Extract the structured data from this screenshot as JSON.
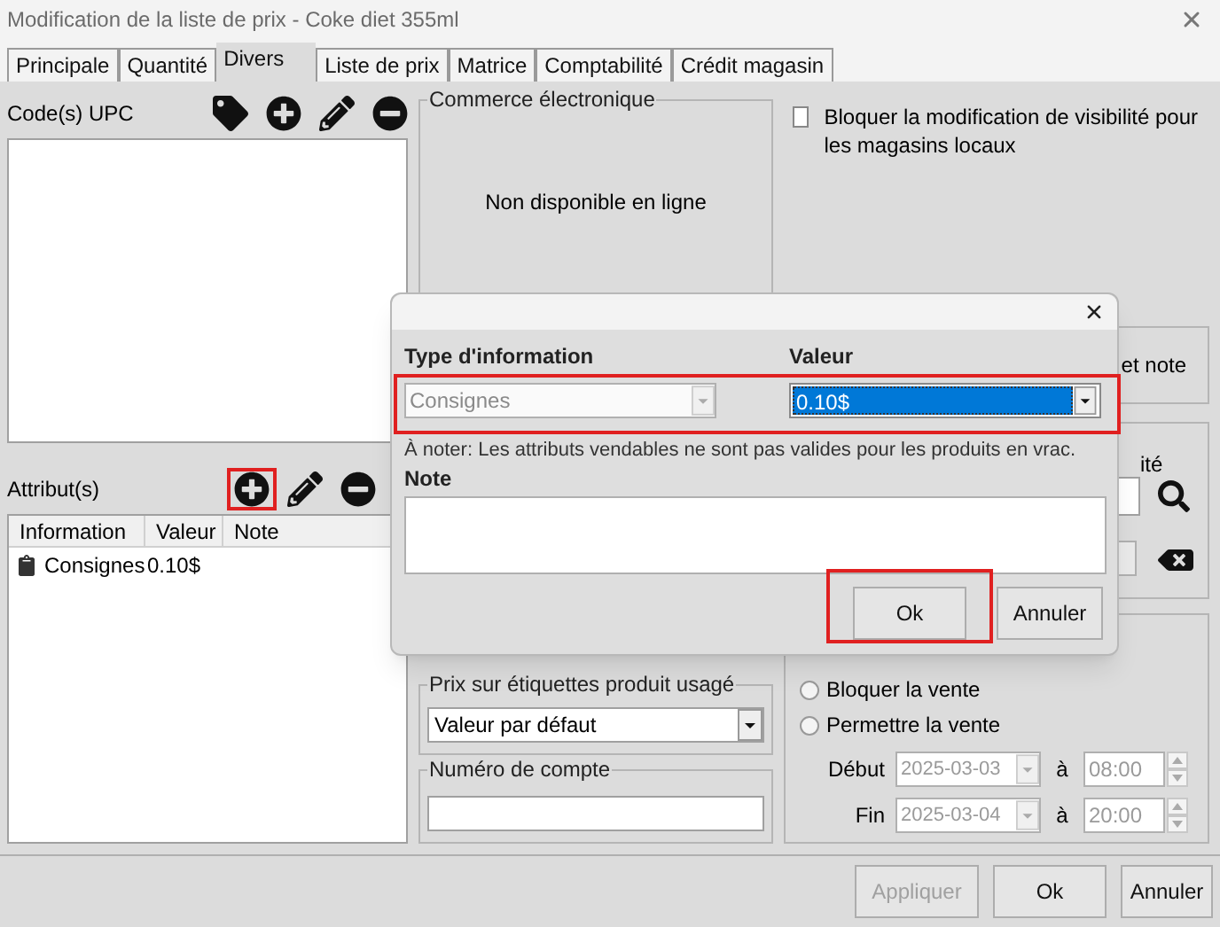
{
  "window": {
    "title": "Modification de la liste de prix - Coke diet 355ml"
  },
  "tabs": [
    {
      "label": "Principale",
      "selected": false
    },
    {
      "label": "Quantité",
      "selected": false
    },
    {
      "label": "Divers",
      "selected": true
    },
    {
      "label": "Liste de prix",
      "selected": false
    },
    {
      "label": "Matrice",
      "selected": false
    },
    {
      "label": "Comptabilité",
      "selected": false
    },
    {
      "label": "Crédit magasin",
      "selected": false
    }
  ],
  "upc": {
    "label": "Code(s) UPC",
    "tools": [
      {
        "kind": "tag",
        "highlighted": false
      },
      {
        "kind": "add",
        "highlighted": false
      },
      {
        "kind": "edit",
        "highlighted": false
      },
      {
        "kind": "remove",
        "highlighted": false
      }
    ]
  },
  "attributes": {
    "label": "Attribut(s)",
    "tools": [
      {
        "kind": "add",
        "highlighted": true
      },
      {
        "kind": "edit",
        "highlighted": false
      },
      {
        "kind": "remove",
        "highlighted": false
      }
    ],
    "columns": [
      "Information",
      "Valeur",
      "Note"
    ],
    "rows": [
      {
        "information": "Consignes",
        "value": "0.10$"
      }
    ]
  },
  "ecommerce": {
    "title": "Commerce électronique",
    "status": "Non disponible en ligne"
  },
  "visibility_lock": {
    "label": "Bloquer la modification de visibilité pour les magasins locaux",
    "checked": false
  },
  "partial_group": {
    "text": "et note"
  },
  "search_group": {
    "label": "ité"
  },
  "used_label_price": {
    "title": "Prix sur étiquettes produit usagé",
    "value": "Valeur par défaut"
  },
  "account": {
    "title": "Numéro de compte"
  },
  "sale": {
    "options": [
      {
        "label": "Bloquer la vente",
        "selected": false
      },
      {
        "label": "Permettre la vente",
        "selected": false
      }
    ],
    "periods": [
      {
        "label": "Début",
        "date": "2025-03-03",
        "at": "à",
        "time": "08:00"
      },
      {
        "label": "Fin",
        "date": "2025-03-04",
        "at": "à",
        "time": "20:00"
      }
    ]
  },
  "buttons": [
    {
      "label": "Appliquer",
      "disabled": true
    },
    {
      "label": "Ok",
      "disabled": false
    },
    {
      "label": "Annuler",
      "disabled": false
    }
  ],
  "dialog": {
    "fields_highlighted": true,
    "type_label": "Type d'information",
    "type_value": "Consignes",
    "type_disabled": true,
    "value_label": "Valeur",
    "value": "0.10$",
    "notice": "À noter: Les attributs vendables ne sont pas valides pour les produits en vrac.",
    "note_label": "Note",
    "buttons": [
      {
        "label": "Ok",
        "highlighted": true
      },
      {
        "label": "Annuler",
        "highlighted": false
      }
    ]
  }
}
